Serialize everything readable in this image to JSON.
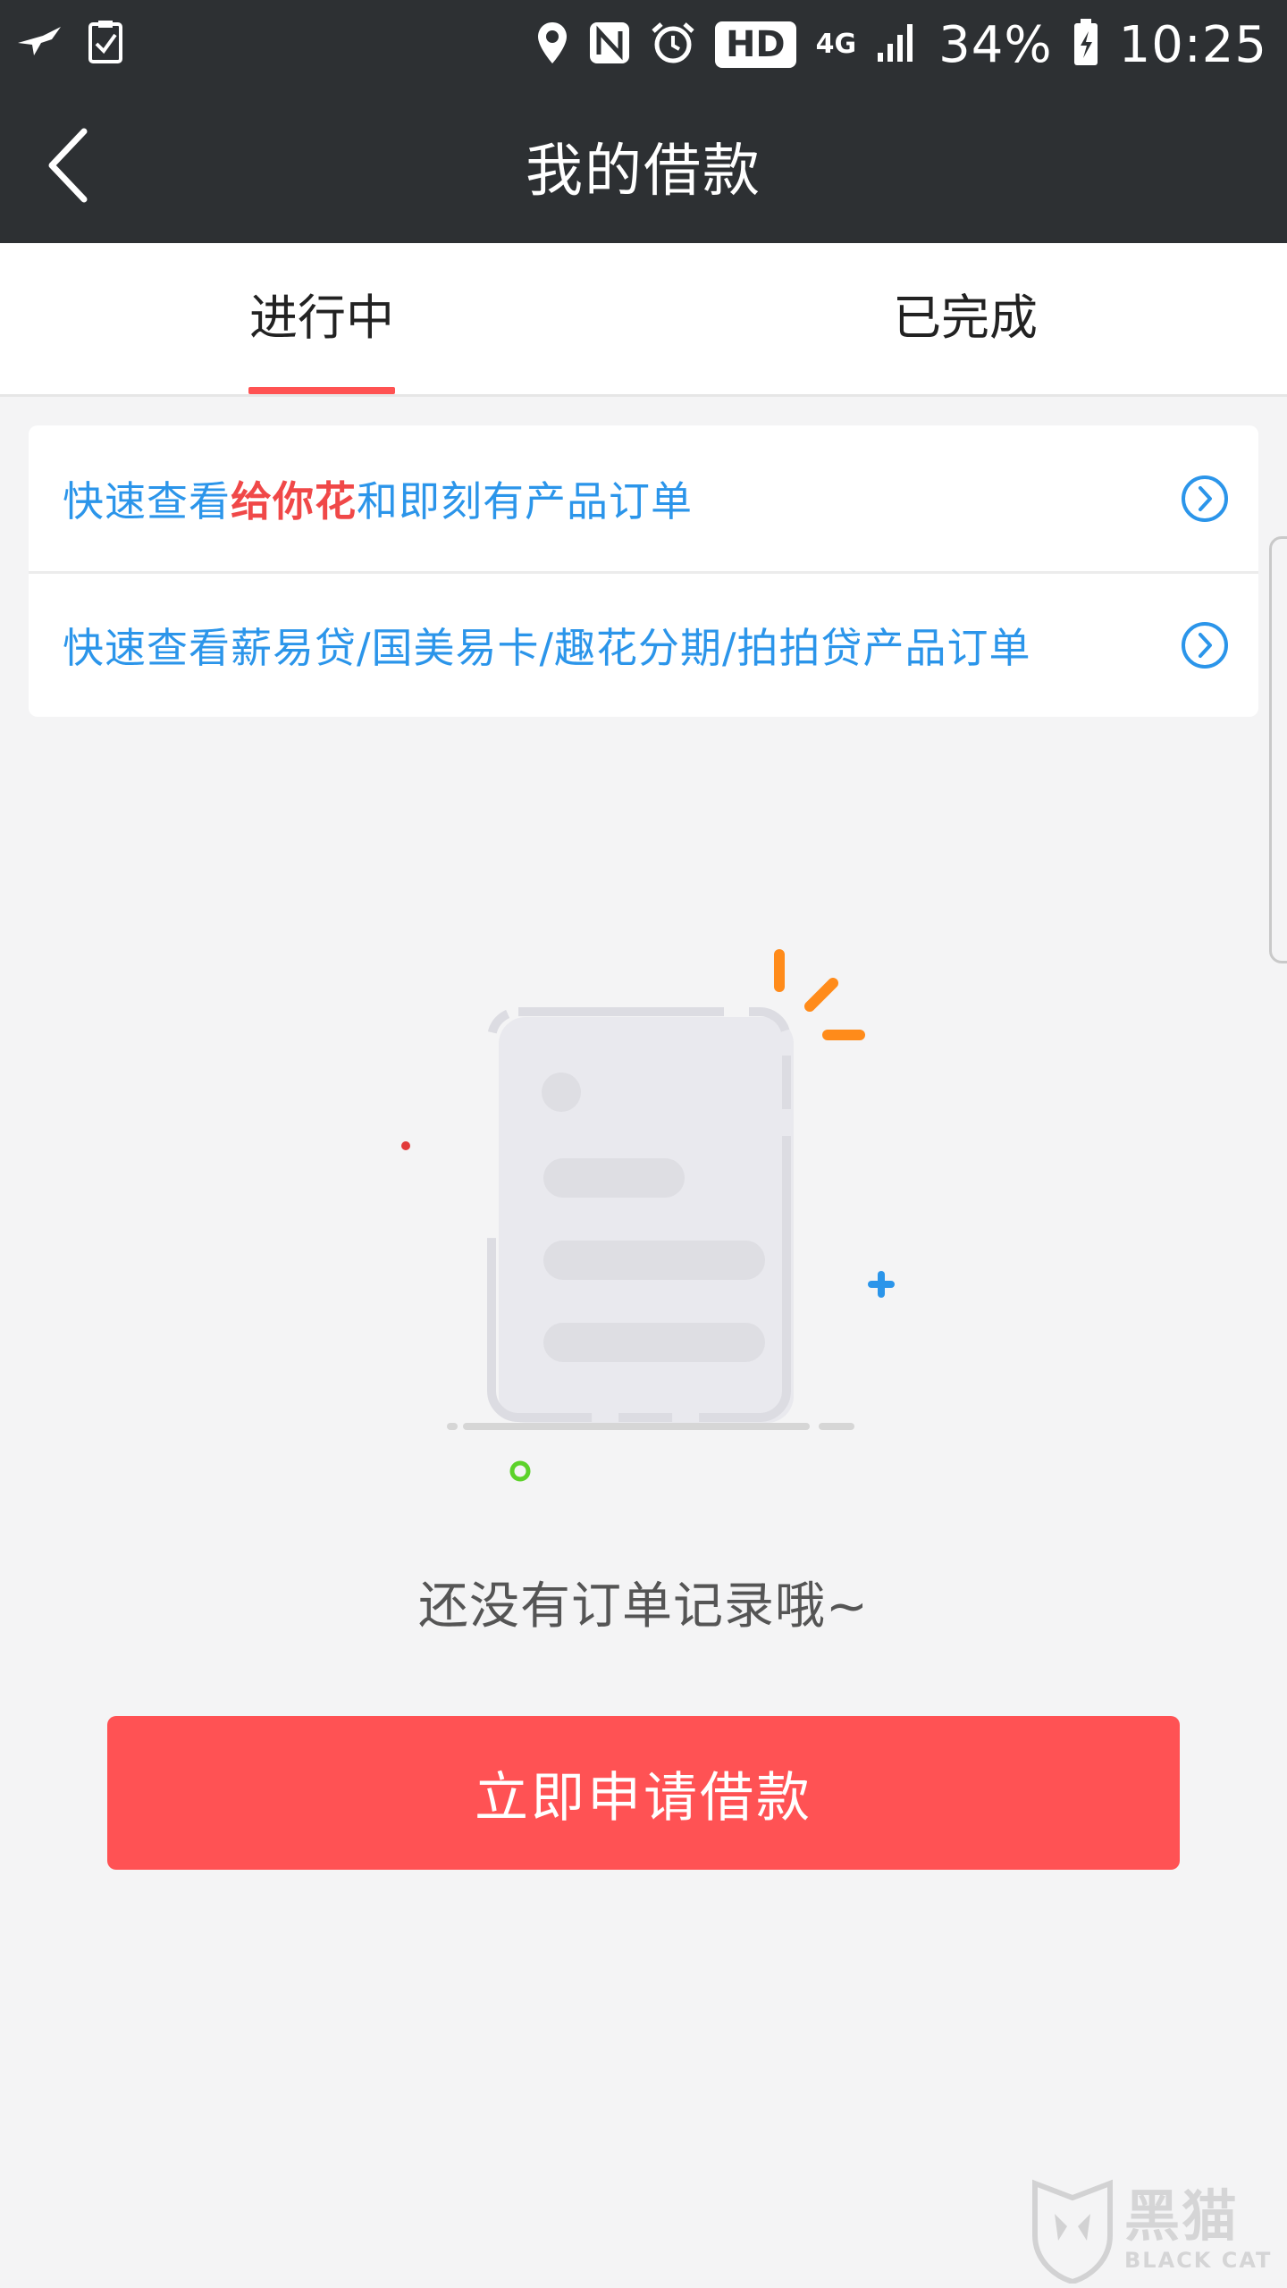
{
  "status_bar": {
    "net_type": "4G",
    "hd": "HD",
    "battery": "34%",
    "time": "10:25"
  },
  "header": {
    "title": "我的借款"
  },
  "tabs": [
    {
      "label": "进行中",
      "active": true
    },
    {
      "label": "已完成",
      "active": false
    }
  ],
  "quick_links": {
    "row1": {
      "prefix": "快速查看",
      "highlight": "给你花",
      "suffix": "和即刻有产品订单"
    },
    "row2": {
      "text": "快速查看薪易贷/国美易卡/趣花分期/拍拍贷产品订单"
    }
  },
  "empty_state": {
    "message": "还没有订单记录哦~"
  },
  "apply_button": {
    "label": "立即申请借款"
  },
  "watermark": {
    "cn": "黑猫",
    "en": "BLACK CAT"
  },
  "colors": {
    "header_bg": "#2d3033",
    "accent": "#ff5252",
    "link_blue": "#2b95ea",
    "page_bg": "#f4f4f5"
  }
}
